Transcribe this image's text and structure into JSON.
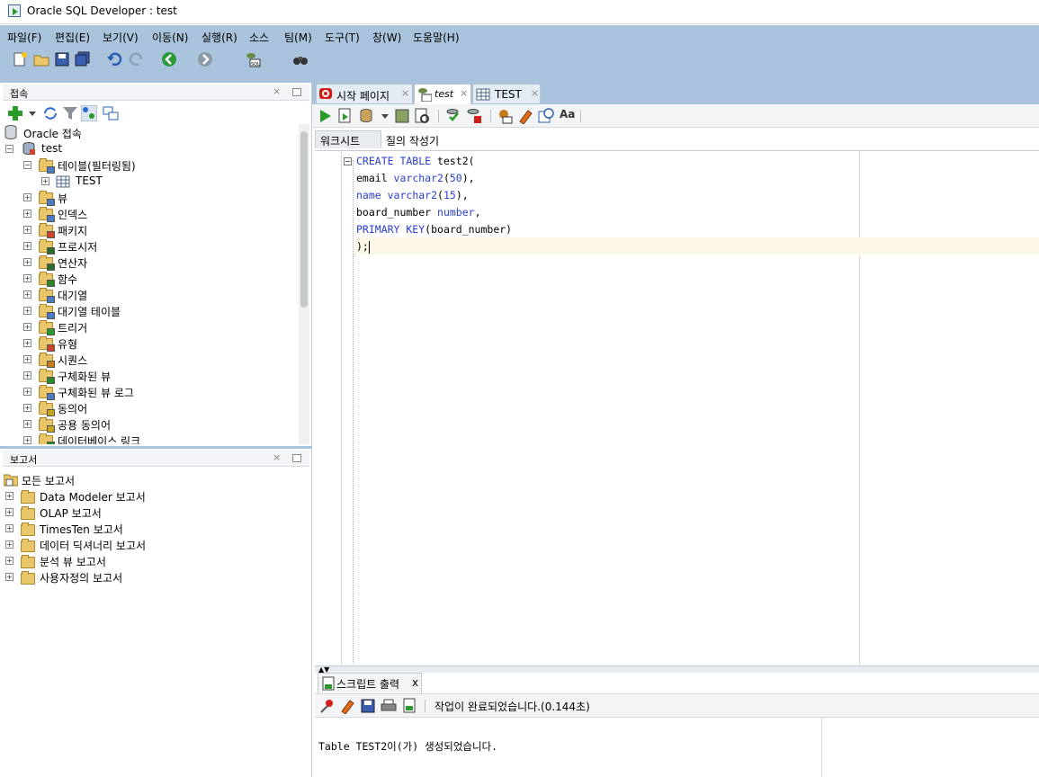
{
  "window": {
    "title": "Oracle SQL Developer : test"
  },
  "menu": [
    "파일(F)",
    "편집(E)",
    "보기(V)",
    "이동(N)",
    "실행(R)",
    "소스",
    "팀(M)",
    "도구(T)",
    "창(W)",
    "도움말(H)"
  ],
  "connections_panel": {
    "title": "접속",
    "root": "Oracle 접속",
    "connection": "test",
    "items": [
      {
        "label": "테이블(필터링됨)",
        "icon": "table-folder-icon",
        "color": "#4a7bc4"
      },
      {
        "label": "TEST",
        "icon": "table-icon",
        "color": "#4a7bc4"
      },
      {
        "label": "뷰",
        "icon": "view-folder-icon",
        "color": "#4a7bc4"
      },
      {
        "label": "인덱스",
        "icon": "index-folder-icon",
        "color": "#4a7bc4"
      },
      {
        "label": "패키지",
        "icon": "package-folder-icon",
        "color": "#d0432a"
      },
      {
        "label": "프로시저",
        "icon": "procedure-folder-icon",
        "color": "#2a6a2a"
      },
      {
        "label": "연산자",
        "icon": "operator-folder-icon",
        "color": "#2a6a2a"
      },
      {
        "label": "함수",
        "icon": "function-folder-icon",
        "color": "#2a8a2a"
      },
      {
        "label": "대기열",
        "icon": "queue-folder-icon",
        "color": "#4a7bc4"
      },
      {
        "label": "대기열 테이블",
        "icon": "queue-table-folder-icon",
        "color": "#4a7bc4"
      },
      {
        "label": "트리거",
        "icon": "trigger-folder-icon",
        "color": "#2a9a2a"
      },
      {
        "label": "유형",
        "icon": "type-folder-icon",
        "color": "#d0432a"
      },
      {
        "label": "시퀀스",
        "icon": "sequence-folder-icon",
        "color": "#c87a1a"
      },
      {
        "label": "구체화된 뷰",
        "icon": "mview-folder-icon",
        "color": "#2a8a2a"
      },
      {
        "label": "구체화된 뷰 로그",
        "icon": "mview-log-folder-icon",
        "color": "#4a7bc4"
      },
      {
        "label": "동의어",
        "icon": "synonym-folder-icon",
        "color": "#c8a41a"
      },
      {
        "label": "공용 동의어",
        "icon": "public-synonym-folder-icon",
        "color": "#c8a41a"
      },
      {
        "label": "데이터베이스 링크",
        "icon": "dblink-folder-icon",
        "color": "#2a8a2a"
      }
    ]
  },
  "reports_panel": {
    "title": "보고서",
    "root": "모든 보고서",
    "items": [
      "Data Modeler 보고서",
      "OLAP 보고서",
      "TimesTen 보고서",
      "데이터 딕셔너리 보고서",
      "분석 뷰 보고서",
      "사용자정의 보고서"
    ]
  },
  "editor_tabs": [
    {
      "label": "시작 페이지",
      "icon": "oracle-icon"
    },
    {
      "label": "test",
      "icon": "sql-connection-icon",
      "active": true
    },
    {
      "label": "TEST",
      "icon": "table-icon"
    }
  ],
  "worksheet": {
    "subtabs": [
      "워크시트",
      "질의 작성기"
    ],
    "code_lines": [
      [
        {
          "t": "CREATE TABLE ",
          "k": true
        },
        {
          "t": "test2(",
          "k": false
        }
      ],
      [
        {
          "t": "email ",
          "k": false
        },
        {
          "t": "varchar2",
          "k": true
        },
        {
          "t": "(",
          "k": false
        },
        {
          "t": "50",
          "k": true
        },
        {
          "t": "),",
          "k": false
        }
      ],
      [
        {
          "t": "name ",
          "k": true
        },
        {
          "t": "varchar2",
          "k": true
        },
        {
          "t": "(",
          "k": false
        },
        {
          "t": "15",
          "k": true
        },
        {
          "t": "),",
          "k": false
        }
      ],
      [
        {
          "t": "board_number ",
          "k": false
        },
        {
          "t": "number",
          "k": true
        },
        {
          "t": ",",
          "k": false
        }
      ],
      [
        {
          "t": "PRIMARY KEY",
          "k": true
        },
        {
          "t": "(board_number)",
          "k": false
        }
      ],
      [
        {
          "t": ");",
          "k": false
        }
      ]
    ]
  },
  "script_output": {
    "tab_label": "스크립트 출력",
    "close": "x",
    "status": "작업이 완료되었습니다.(0.144초)",
    "output": "Table TEST2이(가) 생성되었습니다."
  },
  "colors": {
    "chrome": "#a9c3dc",
    "keyword": "#2a3ed0",
    "current_line": "#fdf8e6"
  }
}
